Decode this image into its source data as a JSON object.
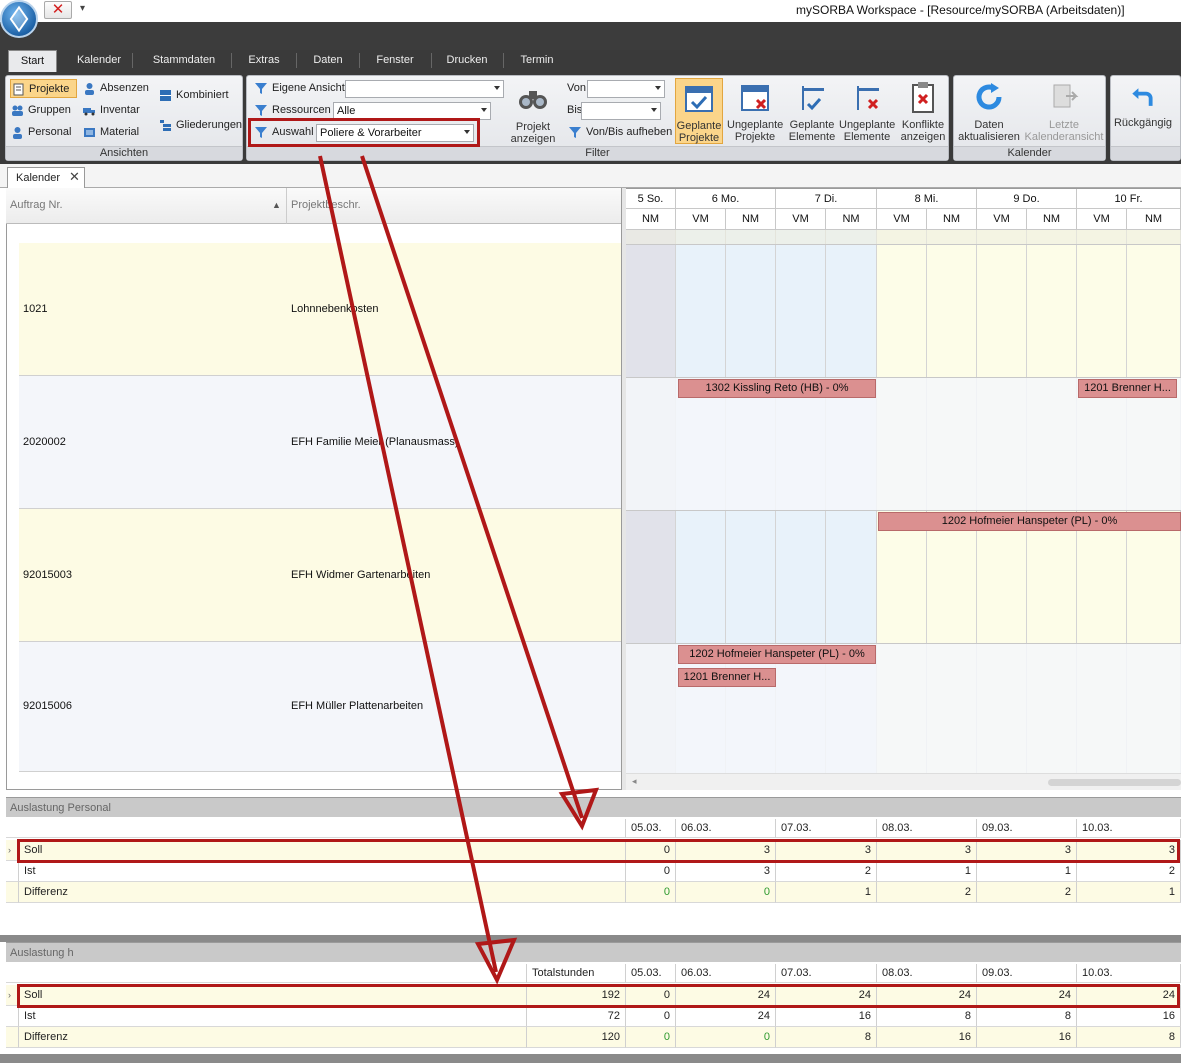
{
  "app": {
    "window_title": "mySORBA Workspace - [Resource/mySORBA (Arbeitsdaten)]",
    "quick_close": "✕",
    "qat_more": "▾"
  },
  "tabs": [
    "Start",
    "Kalender",
    "Stammdaten",
    "Extras",
    "Daten",
    "Fenster",
    "Drucken",
    "Termin"
  ],
  "ribbon": {
    "ansichten": {
      "label": "Ansichten",
      "projekte": "Projekte",
      "gruppen": "Gruppen",
      "personal": "Personal",
      "absenzen": "Absenzen",
      "inventar": "Inventar",
      "material": "Material",
      "kombiniert": "Kombiniert",
      "gliederungen": "Gliederungen"
    },
    "filter": {
      "label": "Filter",
      "eigene_ansicht": "Eigene Ansicht",
      "eigene_ansicht_value": "",
      "ressourcen": "Ressourcen",
      "ressourcen_value": "Alle",
      "auswahl": "Auswahl",
      "auswahl_value": "Poliere & Vorarbeiter",
      "projekt_anzeigen_1": "Projekt",
      "projekt_anzeigen_2": "anzeigen",
      "von": "Von",
      "von_value": "",
      "bis": "Bis",
      "bis_value": "",
      "vonbis_aufheben": "Von/Bis aufheben",
      "geplante_projekte_1": "Geplante",
      "geplante_projekte_2": "Projekte",
      "ungeplante_projekte_1": "Ungeplante",
      "ungeplante_projekte_2": "Projekte",
      "geplante_elemente_1": "Geplante",
      "geplante_elemente_2": "Elemente",
      "ungeplante_elemente_1": "Ungeplante",
      "ungeplante_elemente_2": "Elemente",
      "konflikte_1": "Konflikte",
      "konflikte_2": "anzeigen"
    },
    "kalender": {
      "label": "Kalender",
      "daten_1": "Daten",
      "daten_2": "aktualisieren",
      "letzte_1": "Letzte",
      "letzte_2": "Kalenderansicht"
    },
    "rueckgaengig": "Rückgängig"
  },
  "doctab": {
    "label": "Kalender",
    "close": "✕"
  },
  "left_grid": {
    "columns": [
      "Auftrag Nr.",
      "Projektbeschr."
    ],
    "rows": [
      {
        "nr": "1021",
        "beschr": "Lohnnebenkosten"
      },
      {
        "nr": "2020002",
        "beschr": "EFH Familie Meier (Planausmass)"
      },
      {
        "nr": "92015003",
        "beschr": "EFH Widmer Gartenarbeiten"
      },
      {
        "nr": "92015006",
        "beschr": "EFH Müller Plattenarbeiten"
      }
    ]
  },
  "calendar": {
    "days": [
      "5 So.",
      "6 Mo.",
      "7 Di.",
      "8 Mi.",
      "9 Do.",
      "10 Fr."
    ],
    "slots": [
      "NM",
      "VM",
      "NM",
      "VM",
      "NM",
      "VM",
      "NM",
      "VM",
      "NM",
      "VM",
      "NM"
    ],
    "bars": [
      "1302 Kissling Reto (HB) - 0%",
      "1201 Brenner H...",
      "1202 Hofmeier Hanspeter (PL) - 0%",
      "1202 Hofmeier Hanspeter (PL) - 0%",
      "1201 Brenner H..."
    ]
  },
  "personal": {
    "title": "Auslastung Personal",
    "dates": [
      "05.03.",
      "06.03.",
      "07.03.",
      "08.03.",
      "09.03.",
      "10.03."
    ],
    "rows": [
      {
        "label": "Soll",
        "values": [
          "0",
          "3",
          "3",
          "3",
          "3",
          "3"
        ]
      },
      {
        "label": "Ist",
        "values": [
          "0",
          "3",
          "2",
          "1",
          "1",
          "2"
        ]
      },
      {
        "label": "Differenz",
        "values": [
          "0",
          "0",
          "1",
          "2",
          "2",
          "1"
        ]
      }
    ]
  },
  "stunden": {
    "title": "Auslastung h",
    "total_header": "Totalstunden",
    "dates": [
      "05.03.",
      "06.03.",
      "07.03.",
      "08.03.",
      "09.03.",
      "10.03."
    ],
    "rows": [
      {
        "label": "Soll",
        "total": "192",
        "values": [
          "0",
          "24",
          "24",
          "24",
          "24",
          "24"
        ]
      },
      {
        "label": "Ist",
        "total": "72",
        "values": [
          "0",
          "24",
          "16",
          "8",
          "8",
          "16"
        ]
      },
      {
        "label": "Differenz",
        "total": "120",
        "values": [
          "0",
          "0",
          "8",
          "16",
          "16",
          "8"
        ]
      }
    ]
  },
  "colors": {
    "highlight": "#b01818",
    "bar": "#db9090",
    "selected": "#fbd58a",
    "zero_green": "#2e9a2e"
  }
}
